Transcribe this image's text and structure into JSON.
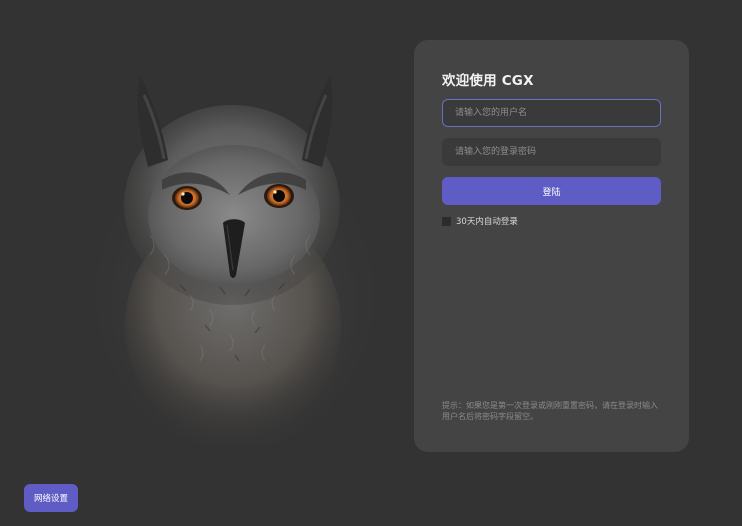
{
  "login": {
    "title": "欢迎使用 CGX",
    "username_placeholder": "请输入您的用户名",
    "password_placeholder": "请输入您的登录密码",
    "login_label": "登陆",
    "remember_label": "30天内自动登录",
    "remember_checked": false,
    "hint": "提示：如果您是第一次登录或刚刚重置密码，请在登录时输入用户名后将密码字段留空。"
  },
  "footer": {
    "network_label": "网络设置"
  },
  "colors": {
    "background": "#333333",
    "card": "#444444",
    "accent": "#5f5cc6",
    "input_focus_border": "#6a6fc4"
  },
  "icons": {
    "hero_image": "owl-illustration"
  }
}
